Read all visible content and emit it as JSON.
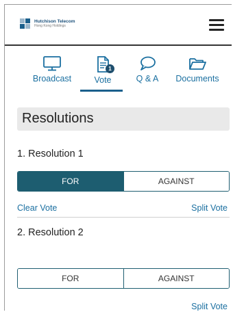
{
  "header": {
    "logo_line1": "Hutchison Telecom",
    "logo_line2": "Hong Kong Holdings"
  },
  "tabs": [
    {
      "label": "Broadcast",
      "icon": "monitor-icon"
    },
    {
      "label": "Vote",
      "icon": "document-icon",
      "badge": "1",
      "active": true
    },
    {
      "label": "Q & A",
      "icon": "speech-bubble-icon"
    },
    {
      "label": "Documents",
      "icon": "folder-icon"
    }
  ],
  "section": {
    "title": "Resolutions"
  },
  "resolutions": [
    {
      "title": "1. Resolution 1",
      "for_label": "FOR",
      "against_label": "AGAINST",
      "selected": "FOR",
      "clear_label": "Clear Vote",
      "split_label": "Split Vote"
    },
    {
      "title": "2. Resolution 2",
      "for_label": "FOR",
      "against_label": "AGAINST",
      "selected": "",
      "split_label": "Split Vote"
    }
  ],
  "colors": {
    "accent": "#1d5d70",
    "link": "#1a6fa0",
    "badge": "#1f4f6e"
  }
}
